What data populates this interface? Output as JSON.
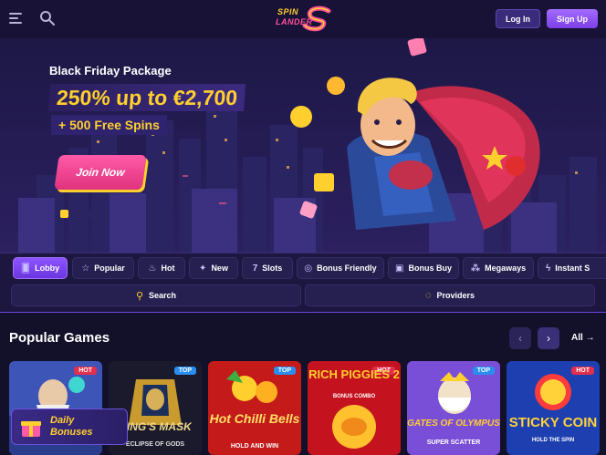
{
  "header": {
    "logo_spin": "SPIN",
    "logo_lander": "LANDER",
    "login_label": "Log In",
    "signup_label": "Sign Up"
  },
  "hero": {
    "title": "Black Friday Package",
    "offer": "250% up to €2,700",
    "spins": "+ 500 Free Spins",
    "cta_label": "Join Now",
    "slides": 4,
    "active_slide": 1
  },
  "tabs": [
    {
      "label": "Lobby",
      "icon": "lobby-icon",
      "active": true
    },
    {
      "label": "Popular",
      "icon": "star-icon"
    },
    {
      "label": "Hot",
      "icon": "flame-icon"
    },
    {
      "label": "New",
      "icon": "sparkle-icon"
    },
    {
      "label": "Slots",
      "icon": "slots-icon"
    },
    {
      "label": "Bonus Friendly",
      "icon": "coin-icon"
    },
    {
      "label": "Bonus Buy",
      "icon": "bag-icon"
    },
    {
      "label": "Megaways",
      "icon": "megaways-icon"
    },
    {
      "label": "Instant S",
      "icon": "bolt-icon"
    }
  ],
  "search_label": "Search",
  "providers_label": "Providers",
  "popular": {
    "title": "Popular Games",
    "all_label": "All",
    "games": [
      {
        "name": "",
        "badge": "HOT"
      },
      {
        "name": "KING'S MASK",
        "subtitle": "ECLIPSE OF GODS",
        "badge": "TOP"
      },
      {
        "name": "Hot Chilli Bells",
        "subtitle": "HOLD AND WIN",
        "badge": "TOP"
      },
      {
        "name": "RICH PIGGIES 2",
        "subtitle": "BONUS COMBO",
        "badge": "HOT"
      },
      {
        "name": "GATES OF OLYMPUS",
        "subtitle": "SUPER SCATTER",
        "badge": "TOP"
      },
      {
        "name": "STICKY COIN",
        "subtitle": "HOLD THE SPIN",
        "badge": "HOT"
      }
    ]
  },
  "daily_bonus": {
    "line1": "Daily",
    "line2": "Bonuses"
  },
  "colors": {
    "accent": "#8d55ff",
    "gold": "#ffcf2e",
    "pink": "#ff5aa8",
    "hot": "#e22f4c",
    "top": "#2a8ef0",
    "bg": "#13102a"
  }
}
